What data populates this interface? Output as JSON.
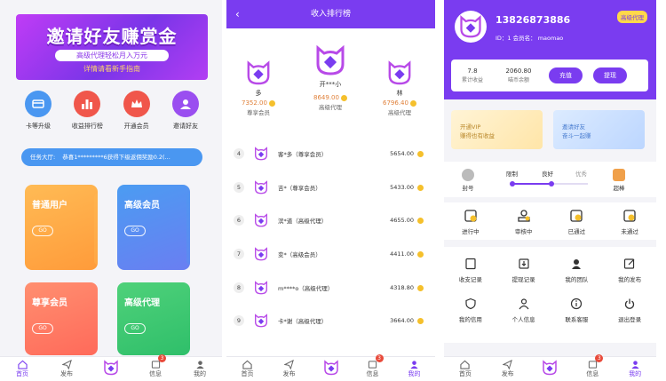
{
  "tabbar": {
    "home": "首页",
    "publish": "发布",
    "messages": "信息",
    "messages_badge": "3",
    "mine": "我的"
  },
  "home": {
    "banner": {
      "title": "邀请好友赚赏金",
      "subtitle": "高级代理轻松月入万元",
      "guide": "详情请看新手指南"
    },
    "quick": [
      {
        "label": "卡等升级"
      },
      {
        "label": "收益排行榜"
      },
      {
        "label": "开通会员"
      },
      {
        "label": "邀请好友"
      }
    ],
    "notice": {
      "prefix": "任务大厅:",
      "text": "恭喜1*********6获得下级返佣奖励0.2(..."
    },
    "cards": [
      {
        "title": "普通用户",
        "go": "GO"
      },
      {
        "title": "高级会员",
        "go": "GO"
      },
      {
        "title": "尊享会员",
        "go": "GO"
      },
      {
        "title": "高级代理",
        "go": "GO"
      }
    ]
  },
  "ranking": {
    "title": "收入排行榜",
    "top3": [
      {
        "rank": "2",
        "name": "多",
        "value": "7352.00",
        "level": "尊享会员"
      },
      {
        "rank": "1",
        "name": "开***小",
        "value": "8649.00",
        "level": "高级代理"
      },
      {
        "rank": "3",
        "name": "林",
        "value": "6796.40",
        "level": "高级代理"
      }
    ],
    "list": [
      {
        "rank": "4",
        "name": "客*多（尊享会员）",
        "value": "5654.00"
      },
      {
        "rank": "5",
        "name": "吉*（尊享会员）",
        "value": "5433.00"
      },
      {
        "rank": "6",
        "name": "滨*道（高级代理）",
        "value": "4655.00"
      },
      {
        "rank": "7",
        "name": "变*（高级会员）",
        "value": "4411.00"
      },
      {
        "rank": "8",
        "name": "m****o（高级代理）",
        "value": "4318.80"
      },
      {
        "rank": "9",
        "name": "卡*谢（高级代理）",
        "value": "3664.00"
      }
    ]
  },
  "profile": {
    "phone": "13826873886",
    "id_line": "ID：1   会员名：   maomao",
    "level": "高级代理",
    "wallet": {
      "income": "7.8",
      "income_label": "累计收益",
      "balance": "2060.80",
      "balance_label": "喵币余额",
      "recharge": "充值",
      "withdraw": "提现"
    },
    "promo": [
      {
        "line1": "开通VIP",
        "line2": "赚得也有收益"
      },
      {
        "line1": "邀请好友",
        "line2": "奋斗一起赚"
      }
    ],
    "credit": {
      "ban": "封号",
      "bad": "限制",
      "good": "良好",
      "excellent": "优秀",
      "super": "超棒"
    },
    "task_status": [
      {
        "label": "进行中"
      },
      {
        "label": "审核中"
      },
      {
        "label": "已通过"
      },
      {
        "label": "未通过"
      }
    ],
    "menu": [
      {
        "label": "收支记录"
      },
      {
        "label": "提现记录"
      },
      {
        "label": "我的团队"
      },
      {
        "label": "我的发布"
      },
      {
        "label": "我的信用"
      },
      {
        "label": "个人信息"
      },
      {
        "label": "联系客服"
      },
      {
        "label": "退出登录"
      }
    ]
  },
  "colors": {
    "primary": "#7a3cf0",
    "notice": "#4a97f1",
    "gold": "#f5c02c",
    "badge": "#e84a3a"
  }
}
